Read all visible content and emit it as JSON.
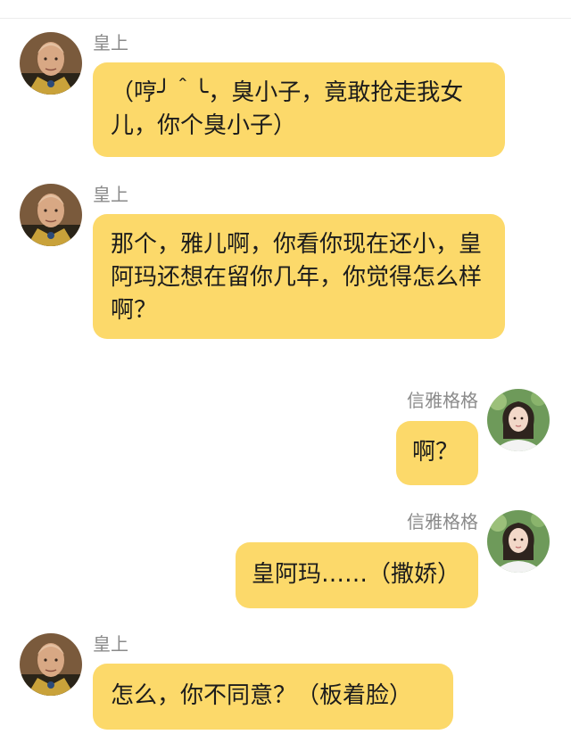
{
  "colors": {
    "bubble": "#fcd96a",
    "sender_name": "#8a8a8a",
    "background": "#ffffff"
  },
  "messages": [
    {
      "sender": "皇上",
      "side": "left",
      "avatar": "emperor-avatar",
      "text": "（哼╯＾╰，臭小子，竟敢抢走我女儿，你个臭小子）"
    },
    {
      "sender": "皇上",
      "side": "left",
      "avatar": "emperor-avatar",
      "text": "那个，雅儿啊，你看你现在还小，皇阿玛还想在留你几年，你觉得怎么样啊？"
    },
    {
      "sender": "信雅格格",
      "side": "right",
      "avatar": "princess-avatar",
      "text": "啊？"
    },
    {
      "sender": "信雅格格",
      "side": "right",
      "avatar": "princess-avatar",
      "text": "皇阿玛……（撒娇）"
    },
    {
      "sender": "皇上",
      "side": "left",
      "avatar": "emperor-avatar",
      "text": "怎么，你不同意？（板着脸）"
    }
  ]
}
